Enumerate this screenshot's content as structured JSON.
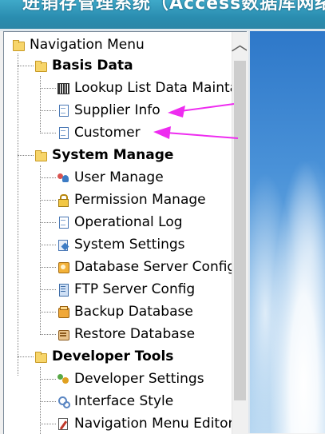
{
  "banner": {
    "title": "进销存管理系统（Access数据库网络版）"
  },
  "nav": {
    "root": "Navigation Menu",
    "groups": [
      {
        "label": "Basis Data",
        "items": [
          "Lookup List Data Maintain",
          "Supplier Info",
          "Customer"
        ]
      },
      {
        "label": "System Manage",
        "items": [
          "User Manage",
          "Permission Manage",
          "Operational Log",
          "System Settings",
          "Database Server Config",
          "FTP Server Config",
          "Backup Database",
          "Restore Database"
        ]
      },
      {
        "label": "Developer Tools",
        "items": [
          "Developer Settings",
          "Interface Style",
          "Navigation Menu Editor"
        ]
      }
    ]
  },
  "colors": {
    "annotation": "#ee2cf0",
    "banner": "#2a8db0"
  }
}
